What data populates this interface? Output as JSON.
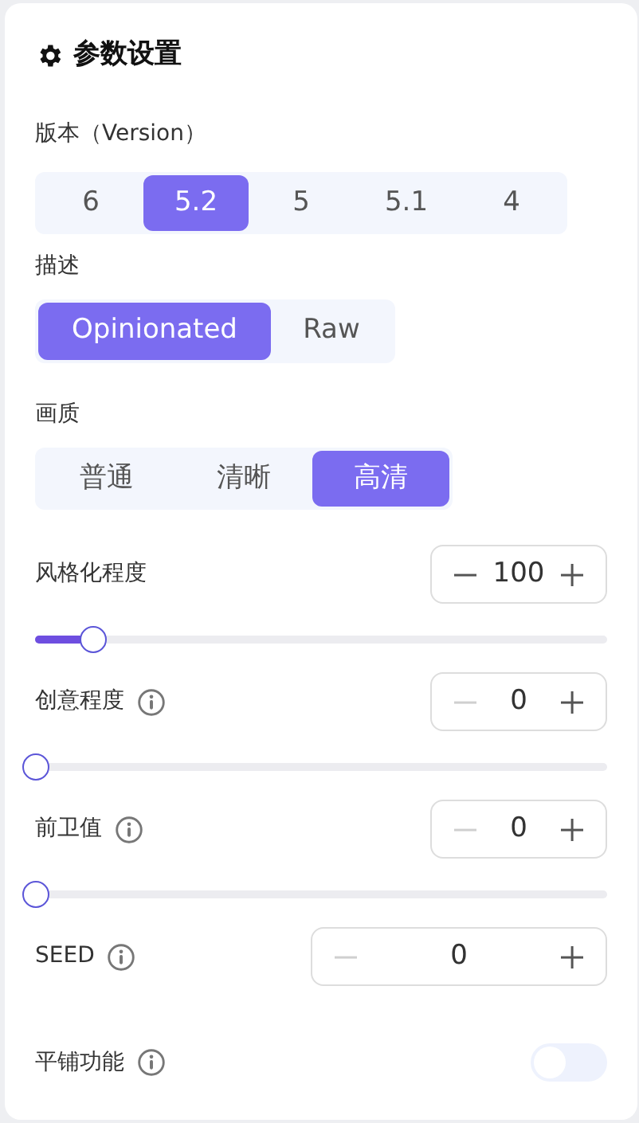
{
  "title": "参数设置",
  "segments": [
    {
      "label": "版本（Version）",
      "options": [
        {
          "label": "6",
          "selected": false
        },
        {
          "label": "5.2",
          "selected": true
        },
        {
          "label": "5",
          "selected": false
        },
        {
          "label": "5.1",
          "selected": false
        },
        {
          "label": "4",
          "selected": false
        }
      ]
    },
    {
      "label": "描述",
      "options": [
        {
          "label": "Opinionated",
          "selected": true
        },
        {
          "label": "Raw",
          "selected": false
        }
      ]
    },
    {
      "label": "画质",
      "options": [
        {
          "label": "普通",
          "selected": false
        },
        {
          "label": "清晰",
          "selected": false
        },
        {
          "label": "高清",
          "selected": true
        }
      ]
    }
  ],
  "params": [
    {
      "kind": "slider",
      "label": "风格化程度",
      "info": false,
      "value": "100",
      "minus_disabled": false,
      "level": 0.1
    },
    {
      "kind": "slider",
      "label": "创意程度",
      "info": true,
      "value": "0",
      "minus_disabled": true,
      "level": 0
    },
    {
      "kind": "slider",
      "label": "前卫值",
      "info": true,
      "value": "0",
      "minus_disabled": true,
      "level": 0
    },
    {
      "kind": "number",
      "label": "SEED",
      "info": true,
      "value": "0",
      "minus_disabled": true
    },
    {
      "kind": "toggle",
      "label": "平铺功能",
      "info": true,
      "on": false
    }
  ]
}
